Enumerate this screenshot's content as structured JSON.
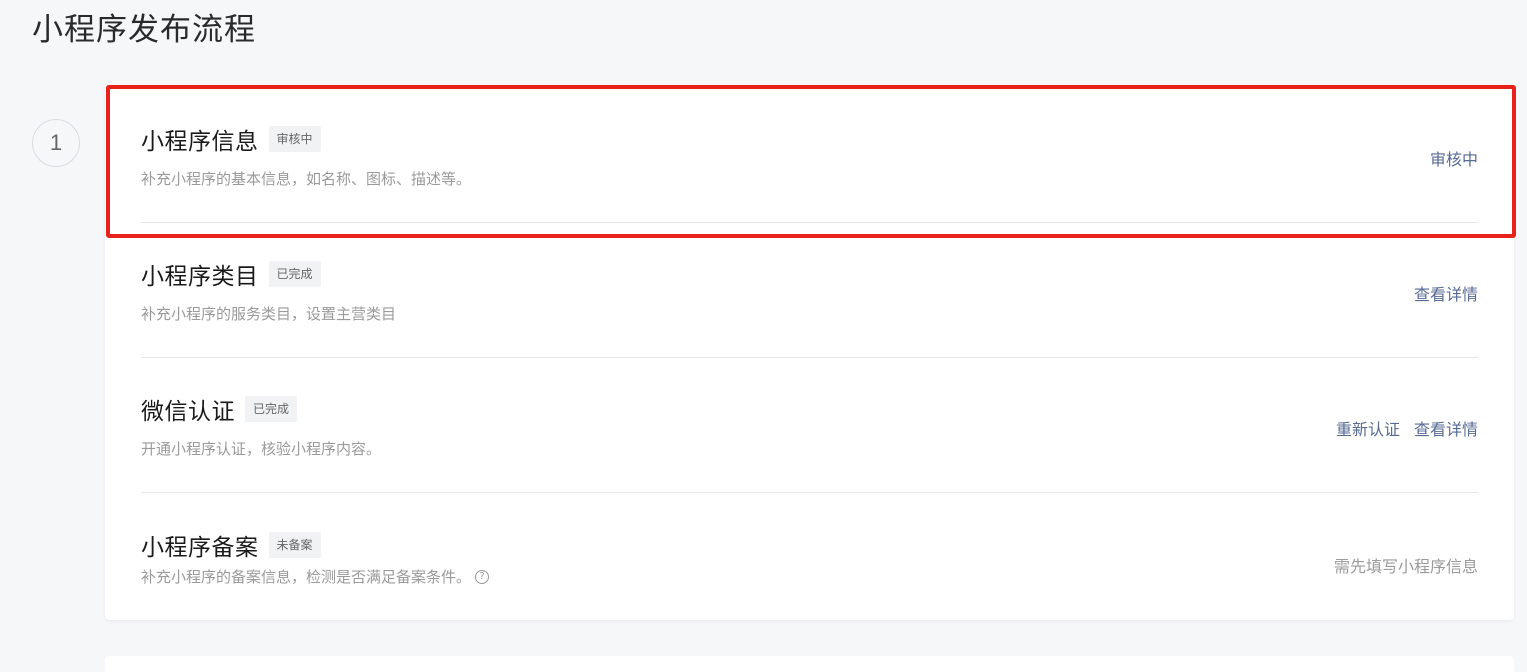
{
  "page": {
    "title": "小程序发布流程"
  },
  "step": {
    "number": "1"
  },
  "rows": [
    {
      "title": "小程序信息",
      "tag": "审核中",
      "desc": "补充小程序的基本信息，如名称、图标、描述等。",
      "action": "审核中"
    },
    {
      "title": "小程序类目",
      "tag": "已完成",
      "desc": "补充小程序的服务类目，设置主营类目",
      "action": "查看详情"
    },
    {
      "title": "微信认证",
      "tag": "已完成",
      "desc": "开通小程序认证，核验小程序内容。",
      "action_reauth": "重新认证",
      "action": "查看详情"
    },
    {
      "title": "小程序备案",
      "tag": "未备案",
      "desc": "补充小程序的备案信息，检测是否满足备案条件。",
      "help_icon": "question-circle-icon",
      "action": "需先填写小程序信息"
    }
  ],
  "colors": {
    "link": "#576b95",
    "highlight": "#e8221b",
    "muted": "#9a9a9a"
  }
}
